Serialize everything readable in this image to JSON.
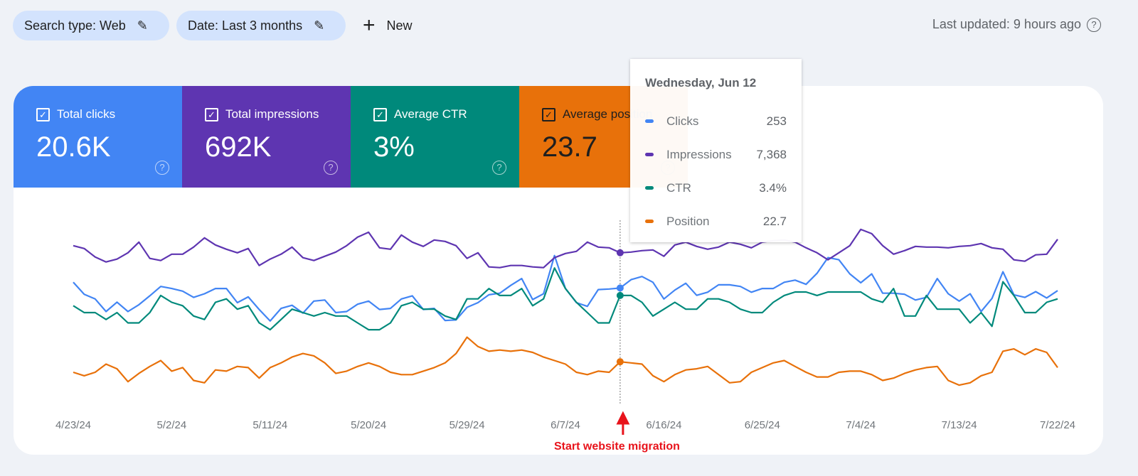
{
  "filters": {
    "search_type": "Search type: Web",
    "date": "Date: Last 3 months",
    "new_label": "New",
    "edit_icon": "pencil-icon",
    "new_icon": "plus-icon"
  },
  "last_updated": "Last updated: 9 hours ago",
  "metrics": [
    {
      "label": "Total clicks",
      "value": "20.6K",
      "color": "#4285f4",
      "checked": true
    },
    {
      "label": "Total impressions",
      "value": "692K",
      "color": "#5e35b1",
      "checked": true
    },
    {
      "label": "Average CTR",
      "value": "3%",
      "color": "#00897b",
      "checked": true
    },
    {
      "label": "Average position",
      "value": "23.7",
      "color": "#e8710a",
      "checked": true
    }
  ],
  "tooltip": {
    "date": "Wednesday, Jun 12",
    "rows": [
      {
        "name": "Clicks",
        "value": "253",
        "color": "#4285f4"
      },
      {
        "name": "Impressions",
        "value": "7,368",
        "color": "#5e35b1"
      },
      {
        "name": "CTR",
        "value": "3.4%",
        "color": "#00897b"
      },
      {
        "name": "Position",
        "value": "22.7",
        "color": "#e8710a"
      }
    ]
  },
  "annotation": {
    "text": "Start website migration",
    "date_index": 50,
    "color": "#e8131b"
  },
  "chart_data": {
    "type": "line",
    "title": "",
    "xlabel": "",
    "ylabel": "",
    "x_start": "4/23/24",
    "x_end": "7/22/24",
    "num_days": 91,
    "x_tick_labels": [
      "4/23/24",
      "5/2/24",
      "5/11/24",
      "5/20/24",
      "5/29/24",
      "6/7/24",
      "6/16/24",
      "6/25/24",
      "7/4/24",
      "7/13/24",
      "7/22/24"
    ],
    "x_tick_interval_days": 9,
    "grid": false,
    "highlight_index": 50,
    "series": [
      {
        "name": "Clicks",
        "color": "#4285f4",
        "ylim": [
          0,
          380
        ],
        "values": [
          248,
          225,
          216,
          192,
          210,
          192,
          205,
          222,
          240,
          236,
          231,
          219,
          226,
          236,
          236,
          209,
          220,
          196,
          174,
          198,
          204,
          189,
          212,
          214,
          190,
          192,
          206,
          212,
          196,
          198,
          216,
          222,
          196,
          198,
          175,
          176,
          200,
          209,
          224,
          227,
          242,
          255,
          215,
          226,
          299,
          236,
          209,
          202,
          234,
          235,
          237,
          253,
          259,
          248,
          216,
          233,
          246,
          223,
          229,
          243,
          243,
          240,
          229,
          236,
          236,
          248,
          252,
          244,
          265,
          295,
          291,
          264,
          247,
          264,
          227,
          227,
          225,
          214,
          219,
          255,
          226,
          212,
          226,
          192,
          217,
          268,
          224,
          219,
          230,
          218,
          232,
          260
        ]
      },
      {
        "name": "Impressions",
        "color": "#5e35b1",
        "ylim": [
          0,
          9200
        ],
        "values": [
          7695,
          7564,
          7171,
          6942,
          7073,
          7368,
          7859,
          7106,
          7008,
          7302,
          7302,
          7630,
          8055,
          7728,
          7532,
          7368,
          7564,
          6778,
          7073,
          7302,
          7630,
          7139,
          7008,
          7204,
          7401,
          7695,
          8088,
          8317,
          7597,
          7532,
          8187,
          7859,
          7663,
          7957,
          7892,
          7695,
          7106,
          7368,
          6713,
          6680,
          6778,
          6778,
          6713,
          6680,
          7139,
          7335,
          7433,
          7859,
          7630,
          7597,
          7368,
          7401,
          7466,
          7499,
          7204,
          7728,
          7859,
          7663,
          7532,
          7630,
          7859,
          7761,
          7597,
          7859,
          7925,
          7957,
          7859,
          7597,
          7368,
          7040,
          7368,
          7695,
          8448,
          8252,
          7695,
          7302,
          7466,
          7663,
          7630,
          7630,
          7597,
          7663,
          7695,
          7794,
          7597,
          7532,
          7040,
          6975,
          7270,
          7302,
          7990
        ]
      },
      {
        "name": "CTR",
        "color": "#00897b",
        "unit": "%",
        "ylim": [
          0,
          5.8
        ],
        "values": [
          3.1,
          2.9,
          2.9,
          2.7,
          2.9,
          2.6,
          2.6,
          2.9,
          3.4,
          3.2,
          3.1,
          2.8,
          2.7,
          3.2,
          3.3,
          3.0,
          3.1,
          2.6,
          2.4,
          2.7,
          3.0,
          2.9,
          2.8,
          2.9,
          2.8,
          2.8,
          2.6,
          2.4,
          2.4,
          2.6,
          3.1,
          3.2,
          3.0,
          3.0,
          2.8,
          2.7,
          3.3,
          3.3,
          3.6,
          3.4,
          3.4,
          3.6,
          3.1,
          3.3,
          4.2,
          3.6,
          3.2,
          2.9,
          2.6,
          2.6,
          3.4,
          3.4,
          3.2,
          2.8,
          3.0,
          3.2,
          3.0,
          3.0,
          3.3,
          3.3,
          3.2,
          3.0,
          2.9,
          2.9,
          3.2,
          3.4,
          3.5,
          3.5,
          3.4,
          3.5,
          3.5,
          3.5,
          3.5,
          3.3,
          3.2,
          3.6,
          2.8,
          2.8,
          3.4,
          3.0,
          3.0,
          3.0,
          2.6,
          2.9,
          2.5,
          3.8,
          3.4,
          2.9,
          2.9,
          3.2,
          3.3
        ]
      },
      {
        "name": "Position",
        "color": "#e8710a",
        "inverted": true,
        "ylim": [
          10,
          27
        ],
        "values": [
          23.6,
          23.9,
          23.6,
          22.9,
          23.3,
          24.4,
          23.7,
          23.1,
          22.6,
          23.5,
          23.2,
          24.3,
          24.5,
          23.4,
          23.5,
          23.1,
          23.2,
          24.1,
          23.2,
          22.8,
          22.3,
          22.0,
          22.2,
          22.8,
          23.7,
          23.5,
          23.1,
          22.8,
          23.1,
          23.6,
          23.8,
          23.8,
          23.5,
          23.2,
          22.8,
          22.0,
          20.6,
          21.4,
          21.8,
          21.7,
          21.8,
          21.7,
          21.9,
          22.3,
          22.6,
          22.9,
          23.6,
          23.8,
          23.5,
          23.6,
          22.7,
          22.8,
          22.9,
          23.9,
          24.4,
          23.8,
          23.4,
          23.3,
          23.1,
          23.8,
          24.5,
          24.4,
          23.6,
          23.2,
          22.8,
          22.6,
          23.1,
          23.6,
          24.0,
          24.0,
          23.6,
          23.5,
          23.5,
          23.8,
          24.3,
          24.1,
          23.7,
          23.4,
          23.2,
          23.1,
          24.3,
          24.7,
          24.5,
          23.9,
          23.6,
          21.8,
          21.6,
          22.1,
          21.6,
          21.9,
          23.2
        ]
      }
    ]
  }
}
